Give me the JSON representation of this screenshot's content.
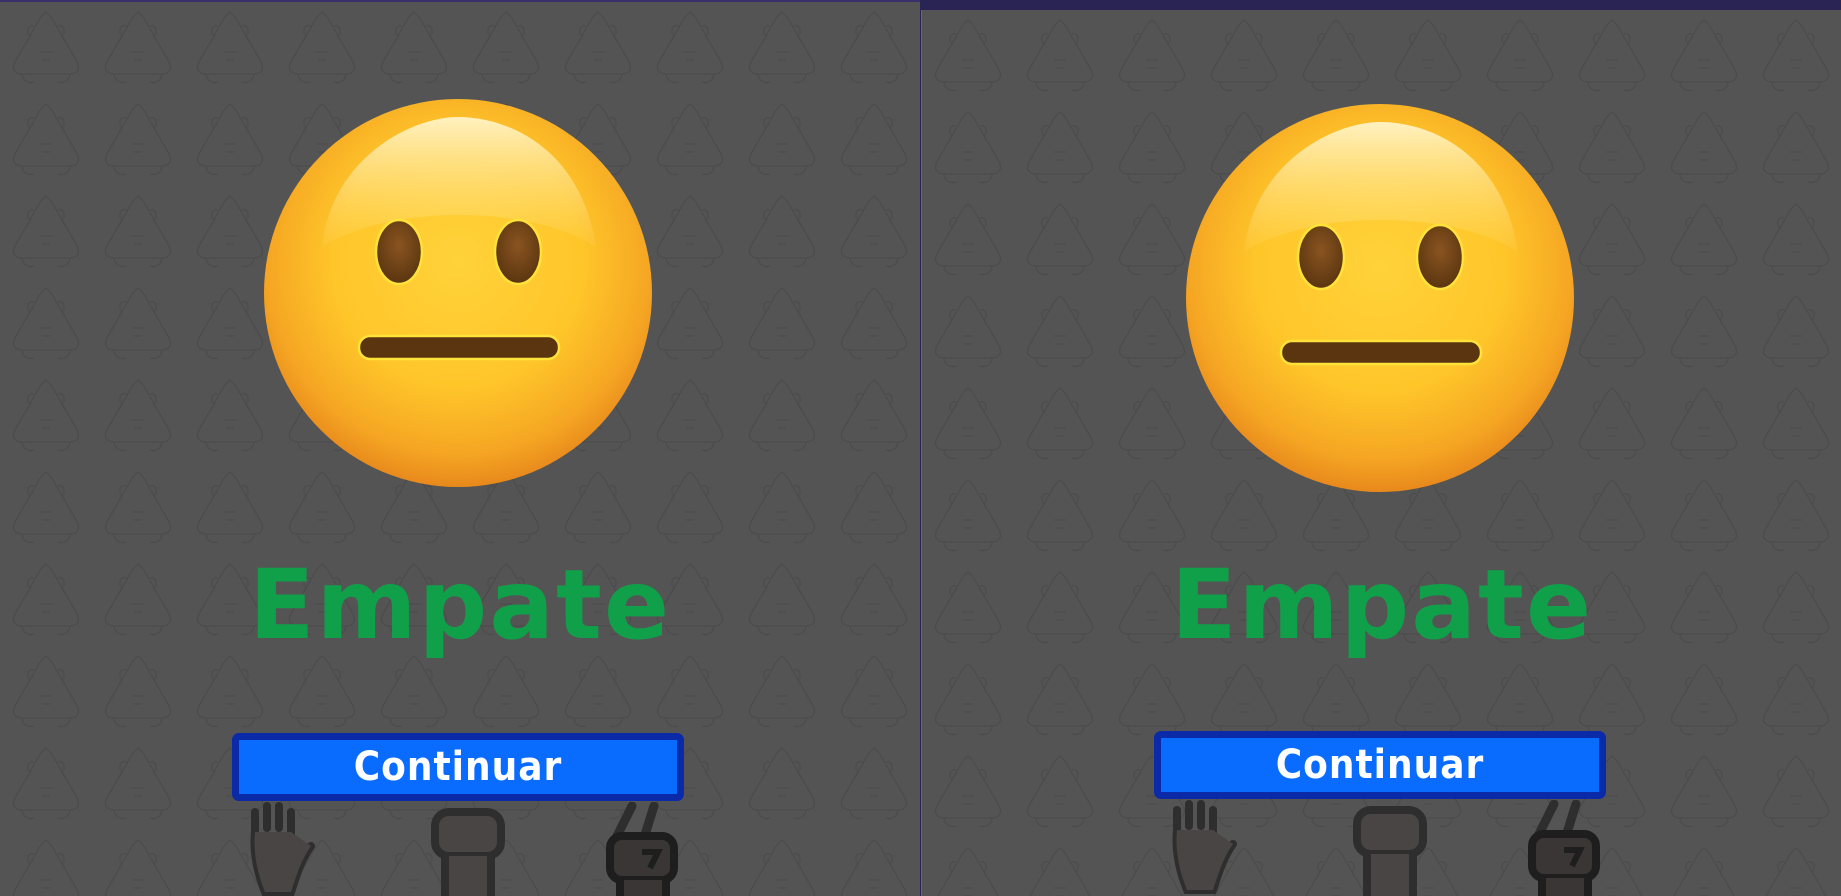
{
  "panels": [
    {
      "side": "left",
      "result_text": "Empate",
      "result_emoji": "neutral-face-icon",
      "continue_label": "Continuar",
      "hand_choices": [
        "paper-hand-icon",
        "rock-hand-icon",
        "scissors-hand-icon"
      ]
    },
    {
      "side": "right",
      "result_text": "Empate",
      "result_emoji": "neutral-face-icon",
      "continue_label": "Continuar",
      "hand_choices": [
        "paper-hand-icon",
        "rock-hand-icon",
        "scissors-hand-icon"
      ]
    }
  ],
  "colors": {
    "background": "#545454",
    "result_text": "#11a04a",
    "button_fill": "#0a6bff",
    "button_border": "#0b2aa8",
    "top_bar": "#3a2f6b"
  }
}
